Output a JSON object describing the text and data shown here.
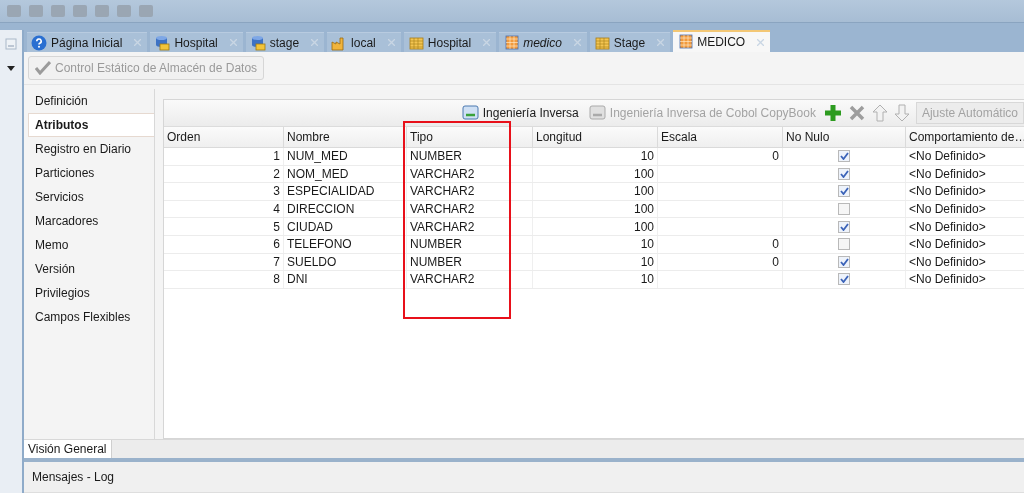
{
  "tabs": [
    {
      "label": "Página Inicial",
      "kind": "help",
      "italic": false,
      "selected": false
    },
    {
      "label": "Hospital",
      "kind": "database",
      "italic": false,
      "selected": false
    },
    {
      "label": "stage",
      "kind": "database",
      "italic": false,
      "selected": false
    },
    {
      "label": "local",
      "kind": "factory",
      "italic": false,
      "selected": false
    },
    {
      "label": "Hospital",
      "kind": "grid",
      "italic": false,
      "selected": false
    },
    {
      "label": "medico",
      "kind": "table",
      "italic": true,
      "selected": false
    },
    {
      "label": "Stage",
      "kind": "grid",
      "italic": false,
      "selected": false
    },
    {
      "label": "MEDICO",
      "kind": "table",
      "italic": false,
      "selected": true
    }
  ],
  "action_button": {
    "label": "Control Estático de Almacén de Datos",
    "disabled": true
  },
  "nav": {
    "items": [
      {
        "label": "Definición",
        "selected": false
      },
      {
        "label": "Atributos",
        "selected": true
      },
      {
        "label": "Registro en Diario",
        "selected": false
      },
      {
        "label": "Particiones",
        "selected": false
      },
      {
        "label": "Servicios",
        "selected": false
      },
      {
        "label": "Marcadores",
        "selected": false
      },
      {
        "label": "Memo",
        "selected": false
      },
      {
        "label": "Versión",
        "selected": false
      },
      {
        "label": "Privilegios",
        "selected": false
      },
      {
        "label": "Campos Flexibles",
        "selected": false
      }
    ]
  },
  "table_toolbar": {
    "items": [
      {
        "kind": "button",
        "label": "Ingeniería Inversa",
        "disabled": false
      },
      {
        "kind": "button",
        "label": "Ingeniería Inversa de Cobol CopyBook",
        "disabled": true
      },
      {
        "kind": "add",
        "disabled": false
      },
      {
        "kind": "delete",
        "disabled": true
      },
      {
        "kind": "up",
        "disabled": true
      },
      {
        "kind": "down",
        "disabled": true
      },
      {
        "kind": "field",
        "label": "Ajuste Automático",
        "disabled": true
      }
    ]
  },
  "table": {
    "columns": [
      {
        "label": "Orden",
        "highlighted": false
      },
      {
        "label": "Nombre",
        "highlighted": false
      },
      {
        "label": "Tipo",
        "highlighted": true
      },
      {
        "label": "Longitud",
        "highlighted": false
      },
      {
        "label": "Escala",
        "highlighted": false
      },
      {
        "label": "No Nulo",
        "highlighted": false
      },
      {
        "label": "Comportamiento de…",
        "highlighted": false
      }
    ],
    "rows": [
      {
        "order": "1",
        "name": "NUM_MED",
        "type": "NUMBER",
        "length": "10",
        "scale": "0",
        "not_null": true,
        "behavior": "<No Definido>"
      },
      {
        "order": "2",
        "name": "NOM_MED",
        "type": "VARCHAR2",
        "length": "100",
        "scale": "",
        "not_null": true,
        "behavior": "<No Definido>"
      },
      {
        "order": "3",
        "name": "ESPECIALIDAD",
        "type": "VARCHAR2",
        "length": "100",
        "scale": "",
        "not_null": true,
        "behavior": "<No Definido>"
      },
      {
        "order": "4",
        "name": "DIRECCION",
        "type": "VARCHAR2",
        "length": "100",
        "scale": "",
        "not_null": false,
        "behavior": "<No Definido>"
      },
      {
        "order": "5",
        "name": "CIUDAD",
        "type": "VARCHAR2",
        "length": "100",
        "scale": "",
        "not_null": true,
        "behavior": "<No Definido>"
      },
      {
        "order": "6",
        "name": "TELEFONO",
        "type": "NUMBER",
        "length": "10",
        "scale": "0",
        "not_null": false,
        "behavior": "<No Definido>"
      },
      {
        "order": "7",
        "name": "SUELDO",
        "type": "NUMBER",
        "length": "10",
        "scale": "0",
        "not_null": true,
        "behavior": "<No Definido>"
      },
      {
        "order": "8",
        "name": "DNI",
        "type": "VARCHAR2",
        "length": "10",
        "scale": "",
        "not_null": true,
        "behavior": "<No Definido>"
      }
    ]
  },
  "bottom_tabs": [
    {
      "label": "Visión General",
      "selected": true
    }
  ],
  "messages": {
    "title": "Mensajes - Log"
  }
}
